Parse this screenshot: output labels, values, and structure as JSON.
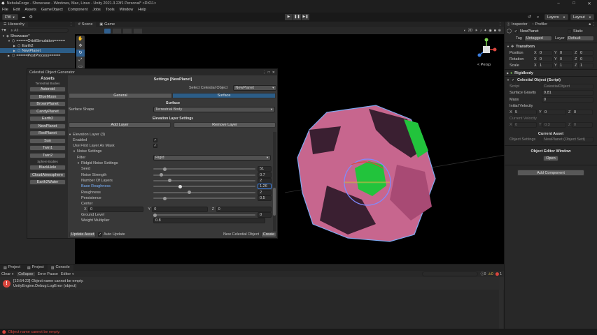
{
  "title_bar": {
    "title": "NebulaForge - Showcase - Windows, Mac, Linux - Unity 2021.3.23f1 Personal* <DX11>"
  },
  "menu": [
    "File",
    "Edit",
    "Assets",
    "GameObject",
    "Component",
    "Jobs",
    "Tools",
    "Window",
    "Help"
  ],
  "toolbar": {
    "account": "FW",
    "layers": "Layers",
    "layout": "Layout"
  },
  "hierarchy": {
    "tab": "Hierarchy",
    "search_placeholder": "All",
    "items": [
      {
        "label": "Showcase*",
        "indent": 0
      },
      {
        "label": "=====OrbitSimulation=====",
        "indent": 1
      },
      {
        "label": "Earth2",
        "indent": 2
      },
      {
        "label": "NewPlanet",
        "indent": 2
      },
      {
        "label": "=====PostProcess=====",
        "indent": 1
      }
    ]
  },
  "scene": {
    "tabs": [
      "Scene",
      "Game"
    ],
    "persp_label": "< Persp"
  },
  "generator": {
    "window_title": "Celestial Object Generator",
    "assets_header": "Assets",
    "terrestrial_header": "Terrestrial Bodies",
    "terrestrial_bodies": [
      "Asteroid",
      "BlueMoon",
      "BrownPlanet",
      "CandyPlanet",
      "Earth2",
      "NewPlanet",
      "RedPlanet",
      "Sun",
      "Twin1",
      "Twin2"
    ],
    "sphere_header": "Sphere Bodies",
    "sphere_bodies": [
      "BlackHole",
      "CloudAtmosphere",
      "Earth2Water"
    ],
    "settings_title": "Settings [NewPlanet]",
    "select_label": "Select Celestial Object",
    "select_value": "NewPlanet",
    "tab_general": "General",
    "tab_surface": "Surface",
    "surface_header": "Surface",
    "surface_shape_label": "Surface Shape",
    "surface_shape_value": "Terrestrial Body",
    "elevation_header": "Elevation Layer Settings",
    "add_layer": "Add Layer",
    "remove_layer": "Remove Layer",
    "elevation_layer": "Elevation Layer (3)",
    "enabled_label": "Enabled",
    "use_first_label": "Use First Layer As Mask",
    "noise_settings": "Noise Settings",
    "filter_label": "Filter",
    "filter_value": "Rigid",
    "rigid_noise": "Ridgid Noise Settings",
    "params": [
      {
        "label": "Seed",
        "value": "51",
        "fraction": 0.1
      },
      {
        "label": "Noise Strength",
        "value": "0.7",
        "fraction": 0.07
      },
      {
        "label": "Number Of Layers",
        "value": "2",
        "fraction": 0.15
      },
      {
        "label": "Base Roughness",
        "value": "1.26",
        "fraction": 0.26,
        "active": true
      },
      {
        "label": "Roughness",
        "value": "2",
        "fraction": 0.35
      },
      {
        "label": "Persistence",
        "value": "0.5",
        "fraction": 0.1
      }
    ],
    "center_label": "Center",
    "center": {
      "x": "0",
      "y": "0",
      "z": "0"
    },
    "ground_level_label": "Ground Level",
    "ground_level_value": "0",
    "weight_mult_label": "Weight Multiplier",
    "weight_mult_value": "0.8",
    "update_asset": "Update Asset",
    "auto_update": "Auto Update",
    "new_celestial_label": "New Celestial Object",
    "create": "Create"
  },
  "inspector": {
    "tabs": [
      "Inspector",
      "Profiler"
    ],
    "object_name": "NewPlanet",
    "static_label": "Static",
    "tag_label": "Tag",
    "tag_value": "Untagged",
    "layer_label": "Layer",
    "layer_value": "Default",
    "transform_title": "Transform",
    "position_label": "Position",
    "rotation_label": "Rotation",
    "scale_label": "Scale",
    "position": {
      "x": "0",
      "y": "0",
      "z": "0"
    },
    "rotation": {
      "x": "0",
      "y": "0",
      "z": "0"
    },
    "scale": {
      "x": "1",
      "y": "1",
      "z": "1"
    },
    "rigidbody_title": "Rigidbody",
    "celestial_title": "Celestial Object (Script)",
    "script_label": "Script",
    "script_value": "CelestialObject",
    "gravity_label": "Surface Gravity",
    "gravity_value": "9.81",
    "mass_label": "Mass",
    "mass_value": "0",
    "init_vel_label": "Initial Velocity",
    "init_vel": {
      "x": "5",
      "y": "0",
      "z": "0"
    },
    "cur_vel_label": "Current Velocity",
    "cur_vel": {
      "x": "0",
      "y": "0.3",
      "z": "0"
    },
    "current_asset_header": "Current Asset",
    "object_settings_label": "Object Settings",
    "object_settings_value": "NewPlanet (Object Sett)",
    "editor_window_header": "Object Editor Window",
    "open_button": "Open",
    "add_component": "Add Component"
  },
  "console": {
    "tabs": [
      "Project",
      "Project",
      "Console"
    ],
    "toolbar": [
      "Clear",
      "Collapse",
      "Error Pause",
      "Editor"
    ],
    "error_count": "1",
    "entry_line1": "[13:54:23] Object name cannot be empty.",
    "entry_line2": "UnityEngine.Debug:LogError (object)"
  },
  "status_bar": {
    "message": "Object name cannot be empty."
  },
  "colors": {
    "accent": "#2f5f8f",
    "selection": "#2c5d87",
    "error": "#d9463e",
    "planet_pink": "#c7668e",
    "planet_green": "#22c33c"
  }
}
